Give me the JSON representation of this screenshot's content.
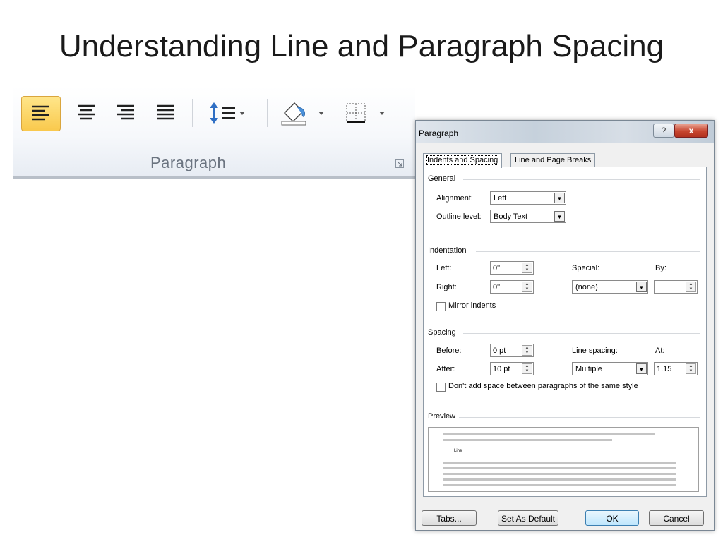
{
  "slide": {
    "title": "Understanding Line and Paragraph Spacing"
  },
  "ribbon": {
    "group_label": "Paragraph",
    "buttons": [
      {
        "name": "align-left",
        "icon": "align-left-icon",
        "active": true
      },
      {
        "name": "align-center",
        "icon": "align-center-icon",
        "active": false
      },
      {
        "name": "align-right",
        "icon": "align-right-icon",
        "active": false
      },
      {
        "name": "justify",
        "icon": "justify-icon",
        "active": false
      },
      {
        "name": "line-spacing",
        "icon": "line-spacing-icon",
        "active": false
      },
      {
        "name": "shading",
        "icon": "paint-bucket-icon",
        "active": false
      },
      {
        "name": "borders",
        "icon": "borders-icon",
        "active": false
      }
    ],
    "accent_color": "#f9c94d"
  },
  "dialog": {
    "title": "Paragraph",
    "help_label": "?",
    "close_label": "x",
    "tabs": [
      {
        "label": "Indents and Spacing",
        "selected": true
      },
      {
        "label": "Line and Page Breaks",
        "selected": false
      }
    ],
    "general": {
      "section_label": "General",
      "alignment_label": "Alignment:",
      "alignment_value": "Left",
      "outline_label": "Outline level:",
      "outline_value": "Body Text"
    },
    "indentation": {
      "section_label": "Indentation",
      "left_label": "Left:",
      "left_value": "0\"",
      "right_label": "Right:",
      "right_value": "0\"",
      "special_label": "Special:",
      "special_value": "(none)",
      "by_label": "By:",
      "by_value": "",
      "mirror_label": "Mirror indents",
      "mirror_checked": false
    },
    "spacing": {
      "section_label": "Spacing",
      "before_label": "Before:",
      "before_value": "0 pt",
      "after_label": "After:",
      "after_value": "10 pt",
      "line_spacing_label": "Line spacing:",
      "line_spacing_value": "Multiple",
      "at_label": "At:",
      "at_value": "1.15",
      "dont_add_label": "Don't add space between paragraphs of the same style",
      "dont_add_checked": false
    },
    "preview": {
      "section_label": "Preview",
      "sample_text": "Line"
    },
    "buttons": {
      "tabs": "Tabs...",
      "set_default": "Set As Default",
      "ok": "OK",
      "cancel": "Cancel"
    }
  }
}
